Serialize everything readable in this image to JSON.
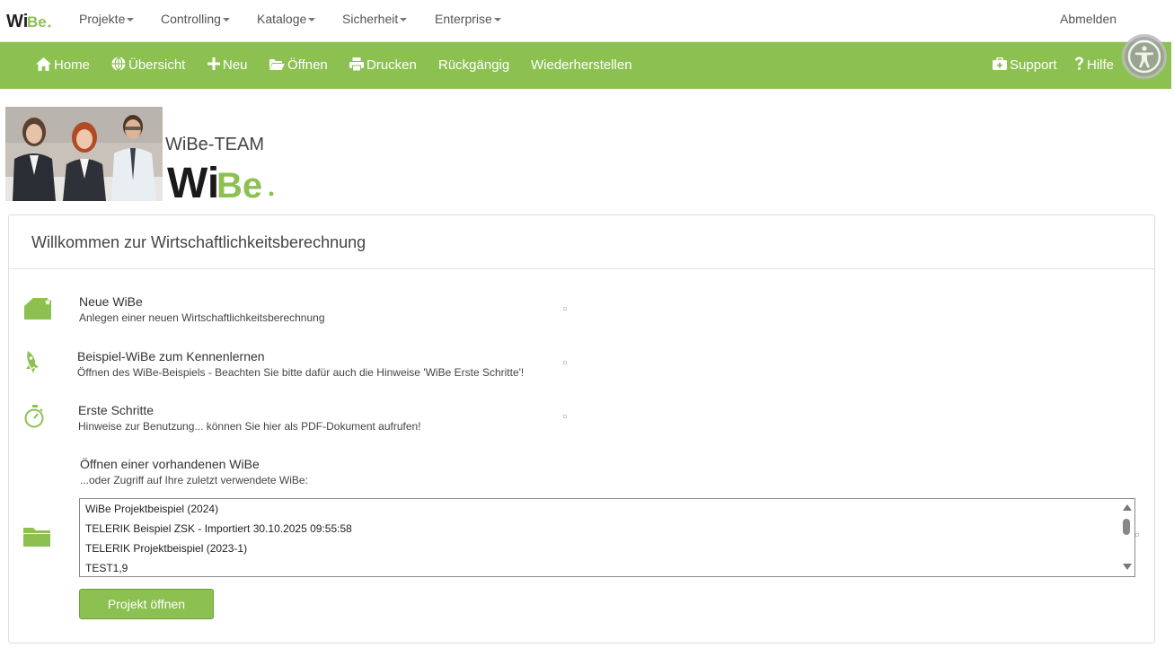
{
  "brand": {
    "logo_text": "WiBe",
    "accent": "#8cc152"
  },
  "top_menu": [
    {
      "label": "Projekte"
    },
    {
      "label": "Controlling"
    },
    {
      "label": "Kataloge"
    },
    {
      "label": "Sicherheit"
    },
    {
      "label": "Enterprise"
    }
  ],
  "logout_label": "Abmelden",
  "toolbar": {
    "home": "Home",
    "overview": "Übersicht",
    "new": "Neu",
    "open": "Öffnen",
    "print": "Drucken",
    "undo": "Rückgängig",
    "redo": "Wiederherstellen",
    "support": "Support",
    "help": "Hilfe"
  },
  "team": {
    "name": "WiBe-TEAM",
    "logo_text": "WiBe"
  },
  "panel": {
    "title": "Willkommen zur Wirtschaftlichkeitsberechnung",
    "entries": [
      {
        "title": "Neue WiBe",
        "desc": "Anlegen einer neuen Wirtschaftlichkeitsberechnung",
        "icon": "new-document-icon"
      },
      {
        "title": "Beispiel-WiBe zum Kennenlernen",
        "desc": "Öffnen des WiBe-Beispiels - Beachten Sie bitte dafür auch die Hinweise 'WiBe Erste Schritte'!",
        "icon": "rocket-icon"
      },
      {
        "title": "Erste Schritte",
        "desc": "Hinweise zur Benutzung... können Sie hier als PDF-Dokument aufrufen!",
        "icon": "compass-icon"
      },
      {
        "title": "Öffnen einer vorhandenen WiBe",
        "desc": "...oder Zugriff auf Ihre zuletzt verwendete WiBe:",
        "icon": "folder-icon"
      }
    ],
    "recent_list": [
      "WiBe Projektbeispiel (2024)",
      "TELERIK Beispiel ZSK - Importiert 30.10.2025 09:55:58",
      "TELERIK Projektbeispiel (2023-1)",
      "TEST1,9"
    ],
    "open_button": "Projekt öffnen"
  }
}
